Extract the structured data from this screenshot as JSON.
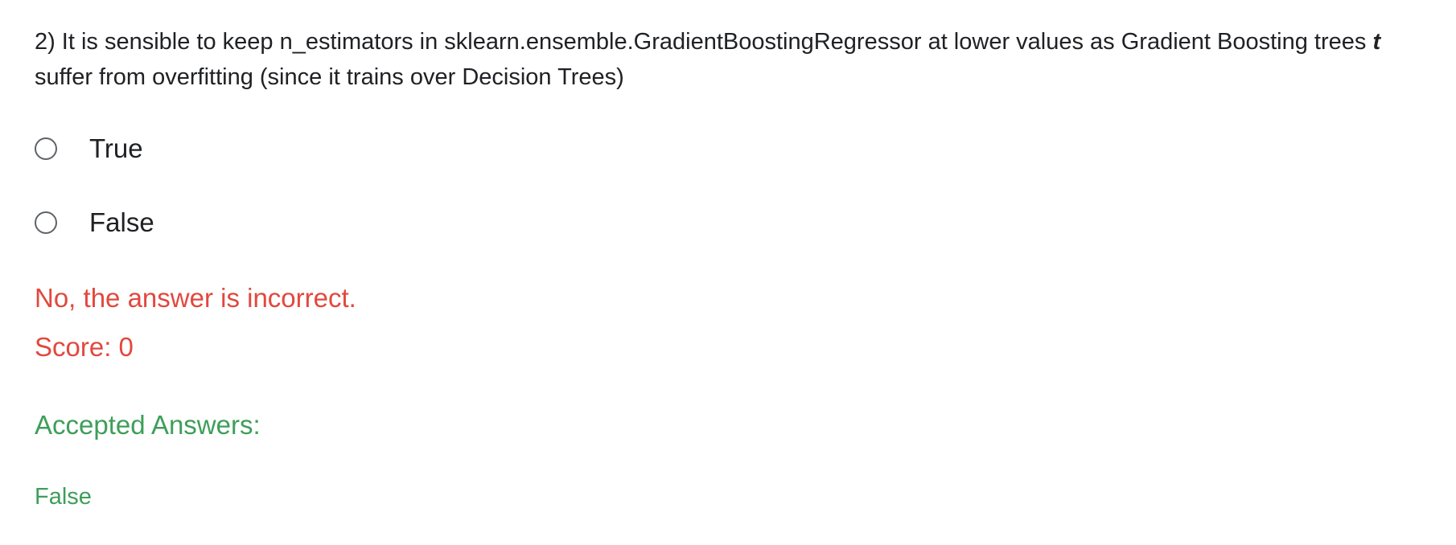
{
  "question": {
    "number": "2)",
    "line1": "It is sensible to keep n_estimators in sklearn.ensemble.GradientBoostingRegressor at lower values as Gradient Boosting trees",
    "overflow_mark": "t",
    "line2": "suffer from overfitting (since it trains over Decision Trees)"
  },
  "options": [
    {
      "label": "True"
    },
    {
      "label": "False"
    }
  ],
  "feedback": {
    "message": "No, the answer is incorrect.",
    "score": "Score: 0",
    "accepted_title": "Accepted Answers:",
    "accepted_answer": "False"
  },
  "colors": {
    "incorrect": "#e2483d",
    "accepted": "#3e9e5a",
    "text": "#202124"
  }
}
